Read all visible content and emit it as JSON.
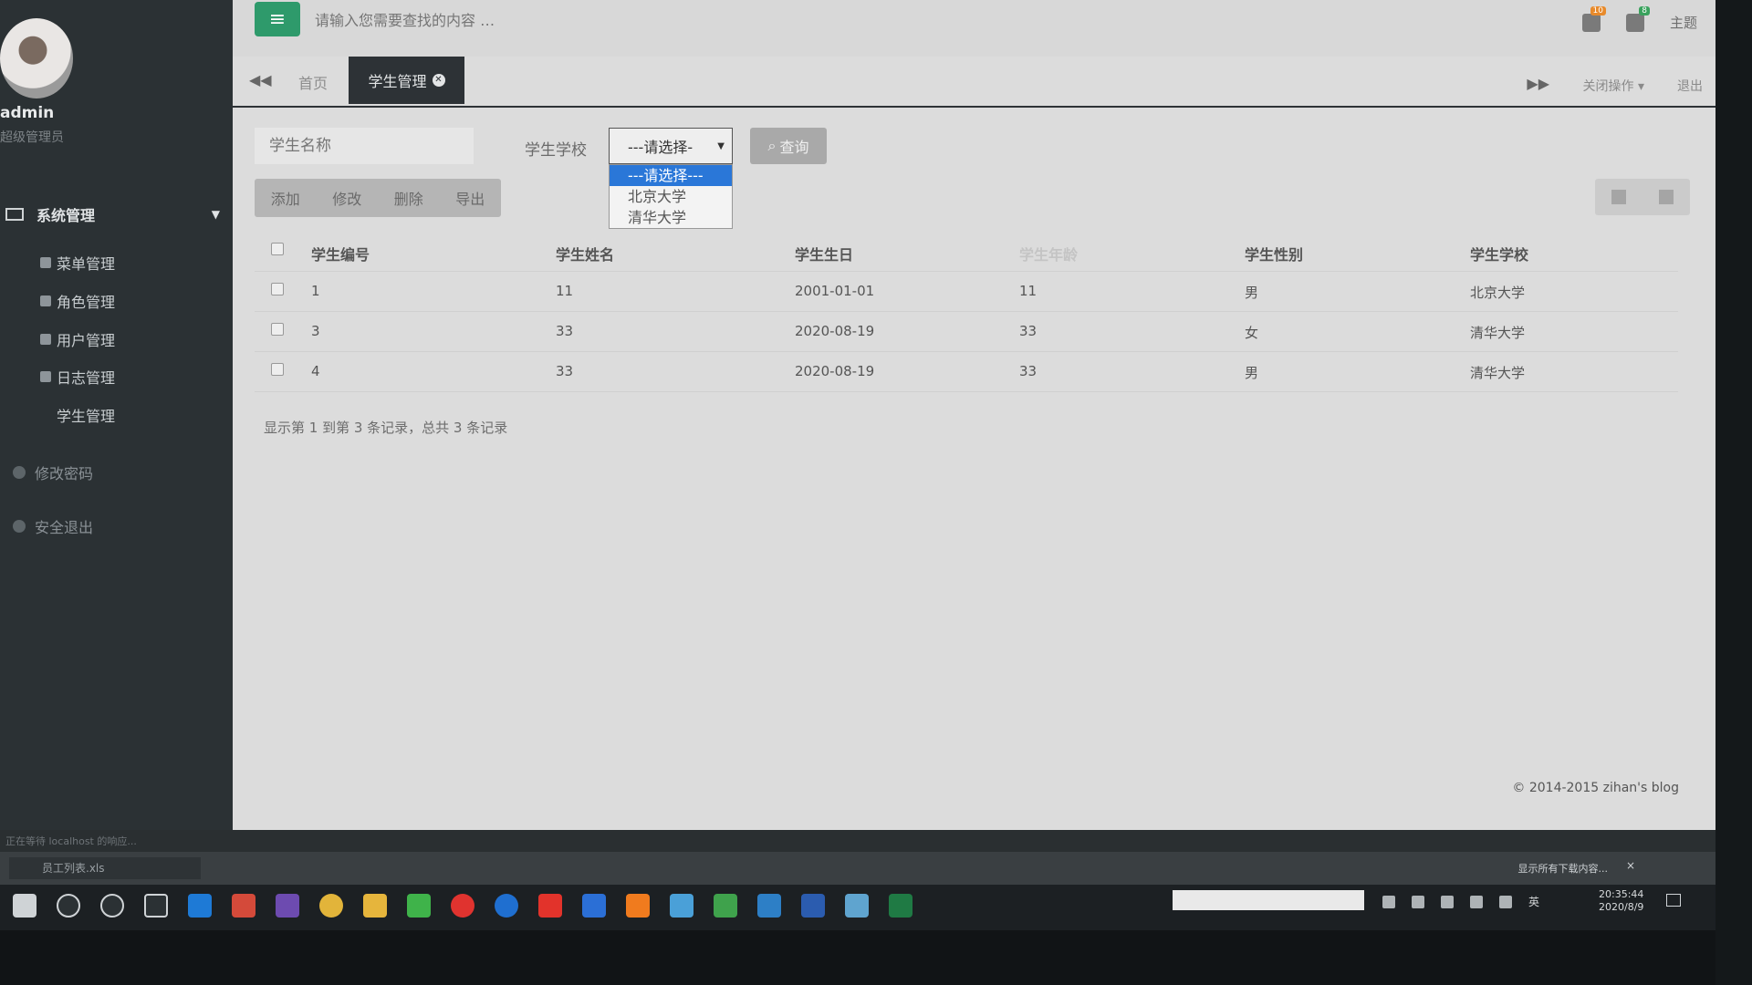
{
  "sidebar": {
    "username": "admin",
    "role": "超级管理员",
    "group": "系统管理",
    "items": [
      {
        "label": "菜单管理"
      },
      {
        "label": "角色管理"
      },
      {
        "label": "用户管理"
      },
      {
        "label": "日志管理"
      },
      {
        "label": "学生管理"
      }
    ],
    "change_password": "修改密码",
    "logout": "安全退出"
  },
  "topbar": {
    "search_placeholder": "请输入您需要查找的内容 …",
    "badge1": "10",
    "badge2": "8",
    "theme": "主题"
  },
  "tabs": {
    "home": "首页",
    "active": "学生管理",
    "close_ops": "关闭操作 ▾",
    "exit": "退出"
  },
  "search": {
    "name_placeholder": "学生名称",
    "school_label": "学生学校",
    "select_value": "---请选择-",
    "options": [
      "---请选择---",
      "北京大学",
      "清华大学"
    ],
    "query_label": "查询"
  },
  "toolbar": {
    "add": "添加",
    "edit": "修改",
    "delete": "删除",
    "export": "导出"
  },
  "table": {
    "headers": [
      "学生编号",
      "学生姓名",
      "学生生日",
      "学生年龄",
      "学生性别",
      "学生学校"
    ],
    "rows": [
      [
        "1",
        "11",
        "2001-01-01",
        "11",
        "男",
        "北京大学"
      ],
      [
        "3",
        "33",
        "2020-08-19",
        "33",
        "女",
        "清华大学"
      ],
      [
        "4",
        "33",
        "2020-08-19",
        "33",
        "男",
        "清华大学"
      ]
    ],
    "footer": "显示第 1 到第 3 条记录，总共 3 条记录"
  },
  "copyright": "© 2014-2015 zihan's blog",
  "browser": {
    "status": "正在等待 localhost 的响应...",
    "download_file": "员工列表.xls",
    "show_all": "显示所有下载内容...",
    "close": "×"
  },
  "taskbar": {
    "lang": "英",
    "time": "20:35:44",
    "date": "2020/8/9"
  },
  "colors": {
    "accent": "#2e9a6b",
    "sidebar_bg": "#2b3134",
    "selected_option": "#2a77d8"
  }
}
